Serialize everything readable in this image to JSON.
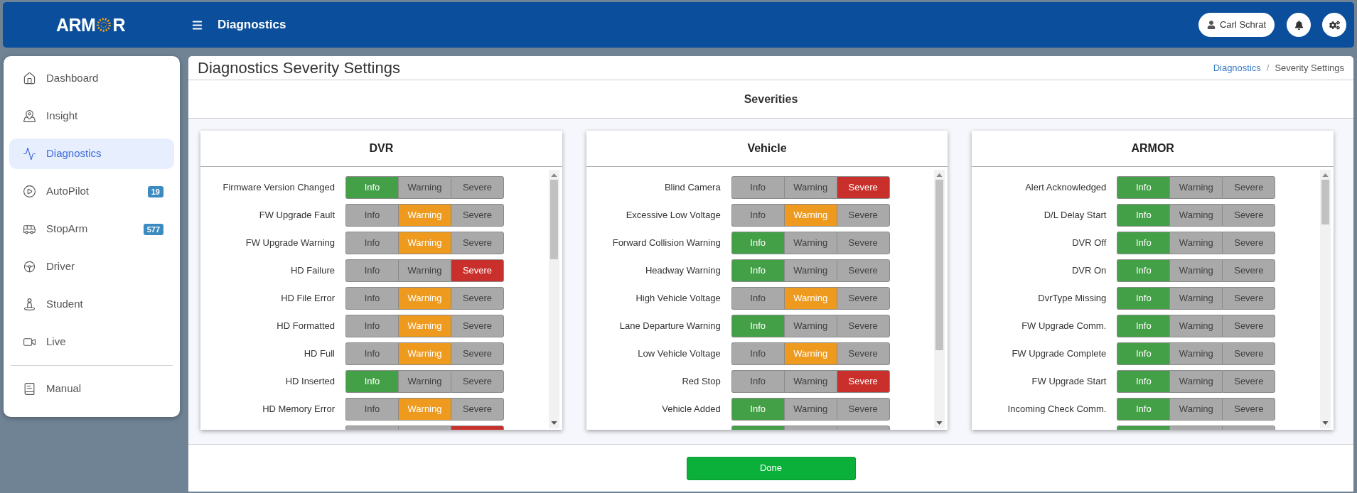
{
  "header": {
    "brand": {
      "lead": "ARM",
      "tail": "R"
    },
    "title": "Diagnostics",
    "user": "Carl Schrat"
  },
  "sidebar": {
    "items": [
      {
        "label": "Dashboard",
        "selected": false
      },
      {
        "label": "Insight",
        "selected": false
      },
      {
        "label": "Diagnostics",
        "selected": true
      },
      {
        "label": "AutoPilot",
        "selected": false,
        "badge": "19"
      },
      {
        "label": "StopArm",
        "selected": false,
        "badge": "577"
      },
      {
        "label": "Driver",
        "selected": false
      },
      {
        "label": "Student",
        "selected": false
      },
      {
        "label": "Live",
        "selected": false
      }
    ],
    "footer_items": [
      {
        "label": "Manual",
        "selected": false
      }
    ]
  },
  "page": {
    "title": "Diagnostics Severity Settings",
    "breadcrumb": [
      {
        "label": "Diagnostics",
        "link": true
      },
      {
        "label": "Severity Settings",
        "link": false
      }
    ],
    "separator": "/"
  },
  "section_title": "Severities",
  "cards": [
    {
      "title": "DVR",
      "rows": [
        {
          "label": "Firmware Version Changed",
          "options": [
            {
              "label": "Info",
              "selected": true
            },
            {
              "label": "Warning",
              "selected": false
            },
            {
              "label": "Severe",
              "selected": false
            }
          ]
        },
        {
          "label": "FW Upgrade Fault",
          "options": [
            {
              "label": "Info",
              "selected": false
            },
            {
              "label": "Warning",
              "selected": true
            },
            {
              "label": "Severe",
              "selected": false
            }
          ]
        },
        {
          "label": "FW Upgrade Warning",
          "options": [
            {
              "label": "Info",
              "selected": false
            },
            {
              "label": "Warning",
              "selected": true
            },
            {
              "label": "Severe",
              "selected": false
            }
          ]
        },
        {
          "label": "HD Failure",
          "options": [
            {
              "label": "Info",
              "selected": false
            },
            {
              "label": "Warning",
              "selected": false
            },
            {
              "label": "Severe",
              "selected": true
            }
          ]
        },
        {
          "label": "HD File Error",
          "options": [
            {
              "label": "Info",
              "selected": false
            },
            {
              "label": "Warning",
              "selected": true
            },
            {
              "label": "Severe",
              "selected": false
            }
          ]
        },
        {
          "label": "HD Formatted",
          "options": [
            {
              "label": "Info",
              "selected": false
            },
            {
              "label": "Warning",
              "selected": true
            },
            {
              "label": "Severe",
              "selected": false
            }
          ]
        },
        {
          "label": "HD Full",
          "options": [
            {
              "label": "Info",
              "selected": false
            },
            {
              "label": "Warning",
              "selected": true
            },
            {
              "label": "Severe",
              "selected": false
            }
          ]
        },
        {
          "label": "HD Inserted",
          "options": [
            {
              "label": "Info",
              "selected": true
            },
            {
              "label": "Warning",
              "selected": false
            },
            {
              "label": "Severe",
              "selected": false
            }
          ]
        },
        {
          "label": "HD Memory Error",
          "options": [
            {
              "label": "Info",
              "selected": false
            },
            {
              "label": "Warning",
              "selected": true
            },
            {
              "label": "Severe",
              "selected": false
            }
          ]
        },
        {
          "options": [
            {
              "selected": false
            },
            {
              "selected": false
            },
            {
              "selected": true
            }
          ]
        }
      ]
    },
    {
      "title": "Vehicle",
      "rows": [
        {
          "label": "Blind Camera",
          "options": [
            {
              "label": "Info",
              "selected": false
            },
            {
              "label": "Warning",
              "selected": false
            },
            {
              "label": "Severe",
              "selected": true
            }
          ]
        },
        {
          "label": "Excessive Low Voltage",
          "options": [
            {
              "label": "Info",
              "selected": false
            },
            {
              "label": "Warning",
              "selected": true
            },
            {
              "label": "Severe",
              "selected": false
            }
          ]
        },
        {
          "label": "Forward Collision Warning",
          "options": [
            {
              "label": "Info",
              "selected": true
            },
            {
              "label": "Warning",
              "selected": false
            },
            {
              "label": "Severe",
              "selected": false
            }
          ]
        },
        {
          "label": "Headway Warning",
          "options": [
            {
              "label": "Info",
              "selected": true
            },
            {
              "label": "Warning",
              "selected": false
            },
            {
              "label": "Severe",
              "selected": false
            }
          ]
        },
        {
          "label": "High Vehicle Voltage",
          "options": [
            {
              "label": "Info",
              "selected": false
            },
            {
              "label": "Warning",
              "selected": true
            },
            {
              "label": "Severe",
              "selected": false
            }
          ]
        },
        {
          "label": "Lane Departure Warning",
          "options": [
            {
              "label": "Info",
              "selected": true
            },
            {
              "label": "Warning",
              "selected": false
            },
            {
              "label": "Severe",
              "selected": false
            }
          ]
        },
        {
          "label": "Low Vehicle Voltage",
          "options": [
            {
              "label": "Info",
              "selected": false
            },
            {
              "label": "Warning",
              "selected": true
            },
            {
              "label": "Severe",
              "selected": false
            }
          ]
        },
        {
          "label": "Red Stop",
          "options": [
            {
              "label": "Info",
              "selected": false
            },
            {
              "label": "Warning",
              "selected": false
            },
            {
              "label": "Severe",
              "selected": true
            }
          ]
        },
        {
          "label": "Vehicle Added",
          "options": [
            {
              "label": "Info",
              "selected": true
            },
            {
              "label": "Warning",
              "selected": false
            },
            {
              "label": "Severe",
              "selected": false
            }
          ]
        },
        {
          "options": [
            {
              "selected": true
            },
            {
              "selected": false
            },
            {
              "selected": false
            }
          ]
        }
      ]
    },
    {
      "title": "ARMOR",
      "rows": [
        {
          "label": "Alert Acknowledged",
          "options": [
            {
              "label": "Info",
              "selected": true
            },
            {
              "label": "Warning",
              "selected": false
            },
            {
              "label": "Severe",
              "selected": false
            }
          ]
        },
        {
          "label": "D/L Delay Start",
          "options": [
            {
              "label": "Info",
              "selected": true
            },
            {
              "label": "Warning",
              "selected": false
            },
            {
              "label": "Severe",
              "selected": false
            }
          ]
        },
        {
          "label": "DVR Off",
          "options": [
            {
              "label": "Info",
              "selected": true
            },
            {
              "label": "Warning",
              "selected": false
            },
            {
              "label": "Severe",
              "selected": false
            }
          ]
        },
        {
          "label": "DVR On",
          "options": [
            {
              "label": "Info",
              "selected": true
            },
            {
              "label": "Warning",
              "selected": false
            },
            {
              "label": "Severe",
              "selected": false
            }
          ]
        },
        {
          "label": "DvrType Missing",
          "options": [
            {
              "label": "Info",
              "selected": true
            },
            {
              "label": "Warning",
              "selected": false
            },
            {
              "label": "Severe",
              "selected": false
            }
          ]
        },
        {
          "label": "FW Upgrade Comm.",
          "options": [
            {
              "label": "Info",
              "selected": true
            },
            {
              "label": "Warning",
              "selected": false
            },
            {
              "label": "Severe",
              "selected": false
            }
          ]
        },
        {
          "label": "FW Upgrade Complete",
          "options": [
            {
              "label": "Info",
              "selected": true
            },
            {
              "label": "Warning",
              "selected": false
            },
            {
              "label": "Severe",
              "selected": false
            }
          ]
        },
        {
          "label": "FW Upgrade Start",
          "options": [
            {
              "label": "Info",
              "selected": true
            },
            {
              "label": "Warning",
              "selected": false
            },
            {
              "label": "Severe",
              "selected": false
            }
          ]
        },
        {
          "label": "Incoming Check Comm.",
          "options": [
            {
              "label": "Info",
              "selected": true
            },
            {
              "label": "Warning",
              "selected": false
            },
            {
              "label": "Severe",
              "selected": false
            }
          ]
        },
        {
          "options": [
            {
              "selected": true
            },
            {
              "selected": false
            },
            {
              "selected": false
            }
          ]
        }
      ]
    }
  ],
  "done_button": "Done"
}
